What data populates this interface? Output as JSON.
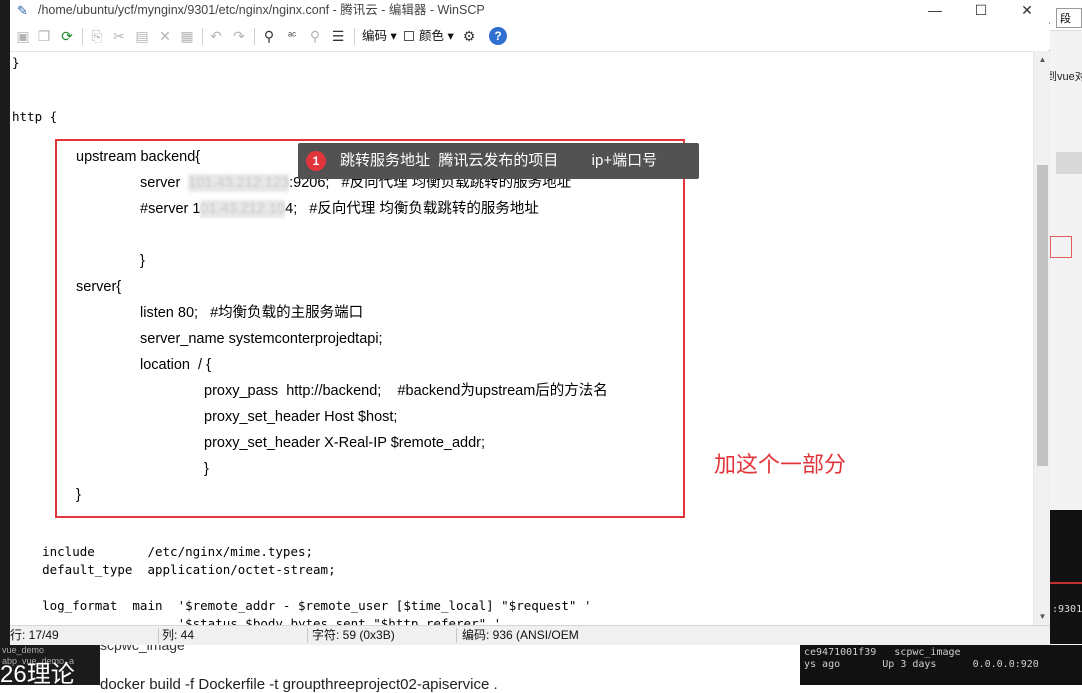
{
  "window": {
    "title": "/home/ubuntu/ycf/mynginx/9301/etc/nginx/nginx.conf - 腾讯云 - 编辑器 - WinSCP",
    "minimize": "—",
    "maximize": "☐",
    "close": "✕"
  },
  "toolbar": {
    "encoding_label": "编码 ▾",
    "color_label": "颜色 ▾",
    "icons": [
      "save-icon",
      "save-all-icon",
      "reload-icon",
      "copy-icon",
      "cut-icon",
      "paste-icon",
      "delete-icon",
      "select-all-icon",
      "undo-icon",
      "redo-icon",
      "find-icon",
      "replace-icon",
      "find-next-icon",
      "goto-line-icon",
      "settings-icon",
      "help-icon"
    ]
  },
  "code_top": {
    "line1": "}",
    "line2": "http {"
  },
  "highlight": {
    "upstream": "upstream backend{",
    "server1_prefix": "server  ",
    "server1_hidden": "101.43.212.123",
    "server1_suffix": ":9206;   #反向代理 均衡负载跳转的服务地址",
    "server2_prefix": "#server 1",
    "server2_hidden": "01.43.212.10",
    "server2_suffix": "4;   #反向代理 均衡负载跳转的服务地址",
    "close1": "}",
    "server_block": "server{",
    "listen": "listen 80;   #均衡负载的主服务端口",
    "server_name": "server_name systemconterprojedtapi;",
    "location": "location  / {",
    "proxy_pass": "proxy_pass  http://backend;    #backend为upstream后的方法名",
    "proxy_header1": "proxy_set_header Host $host;",
    "proxy_header2": "proxy_set_header X-Real-IP $remote_addr;",
    "close2": "}",
    "close3": "}"
  },
  "annotation": {
    "tooltip_number": "1",
    "tooltip_text": "跳转服务地址  腾讯云发布的项目        ip+端口号",
    "note": "加这个一部分",
    "note_color": "#e0353b"
  },
  "code_bottom": {
    "include": "    include       /etc/nginx/mime.types;",
    "default_type": "    default_type  application/octet-stream;",
    "log_format": "    log_format  main  '$remote_addr - $remote_user [$time_local] \"$request\" '",
    "log_format2": "                      '$status $body_bytes_sent \"$http_referer\" '"
  },
  "statusbar": {
    "line": "行: 17/49",
    "column": "列: 44",
    "char": "字符: 59 (0x3B)",
    "encoding": "编码: 936  (ANSI/OEM"
  },
  "background": {
    "right_button": "段落",
    "right_vue": "到vue对",
    "right_port": ":9301",
    "terminal_right": "ce9471001f39   scpwc_image\nys ago       Up 3 days      0.0.0.0:920",
    "left_demo1": "vue_demo",
    "left_demo2": "abp_vue_demo_a",
    "left_big": "26理论",
    "bottom_scpwc": "scpwc_image",
    "bottom_docker": "docker build -f Dockerfile  -t groupthreeproject02-apiservice ."
  }
}
